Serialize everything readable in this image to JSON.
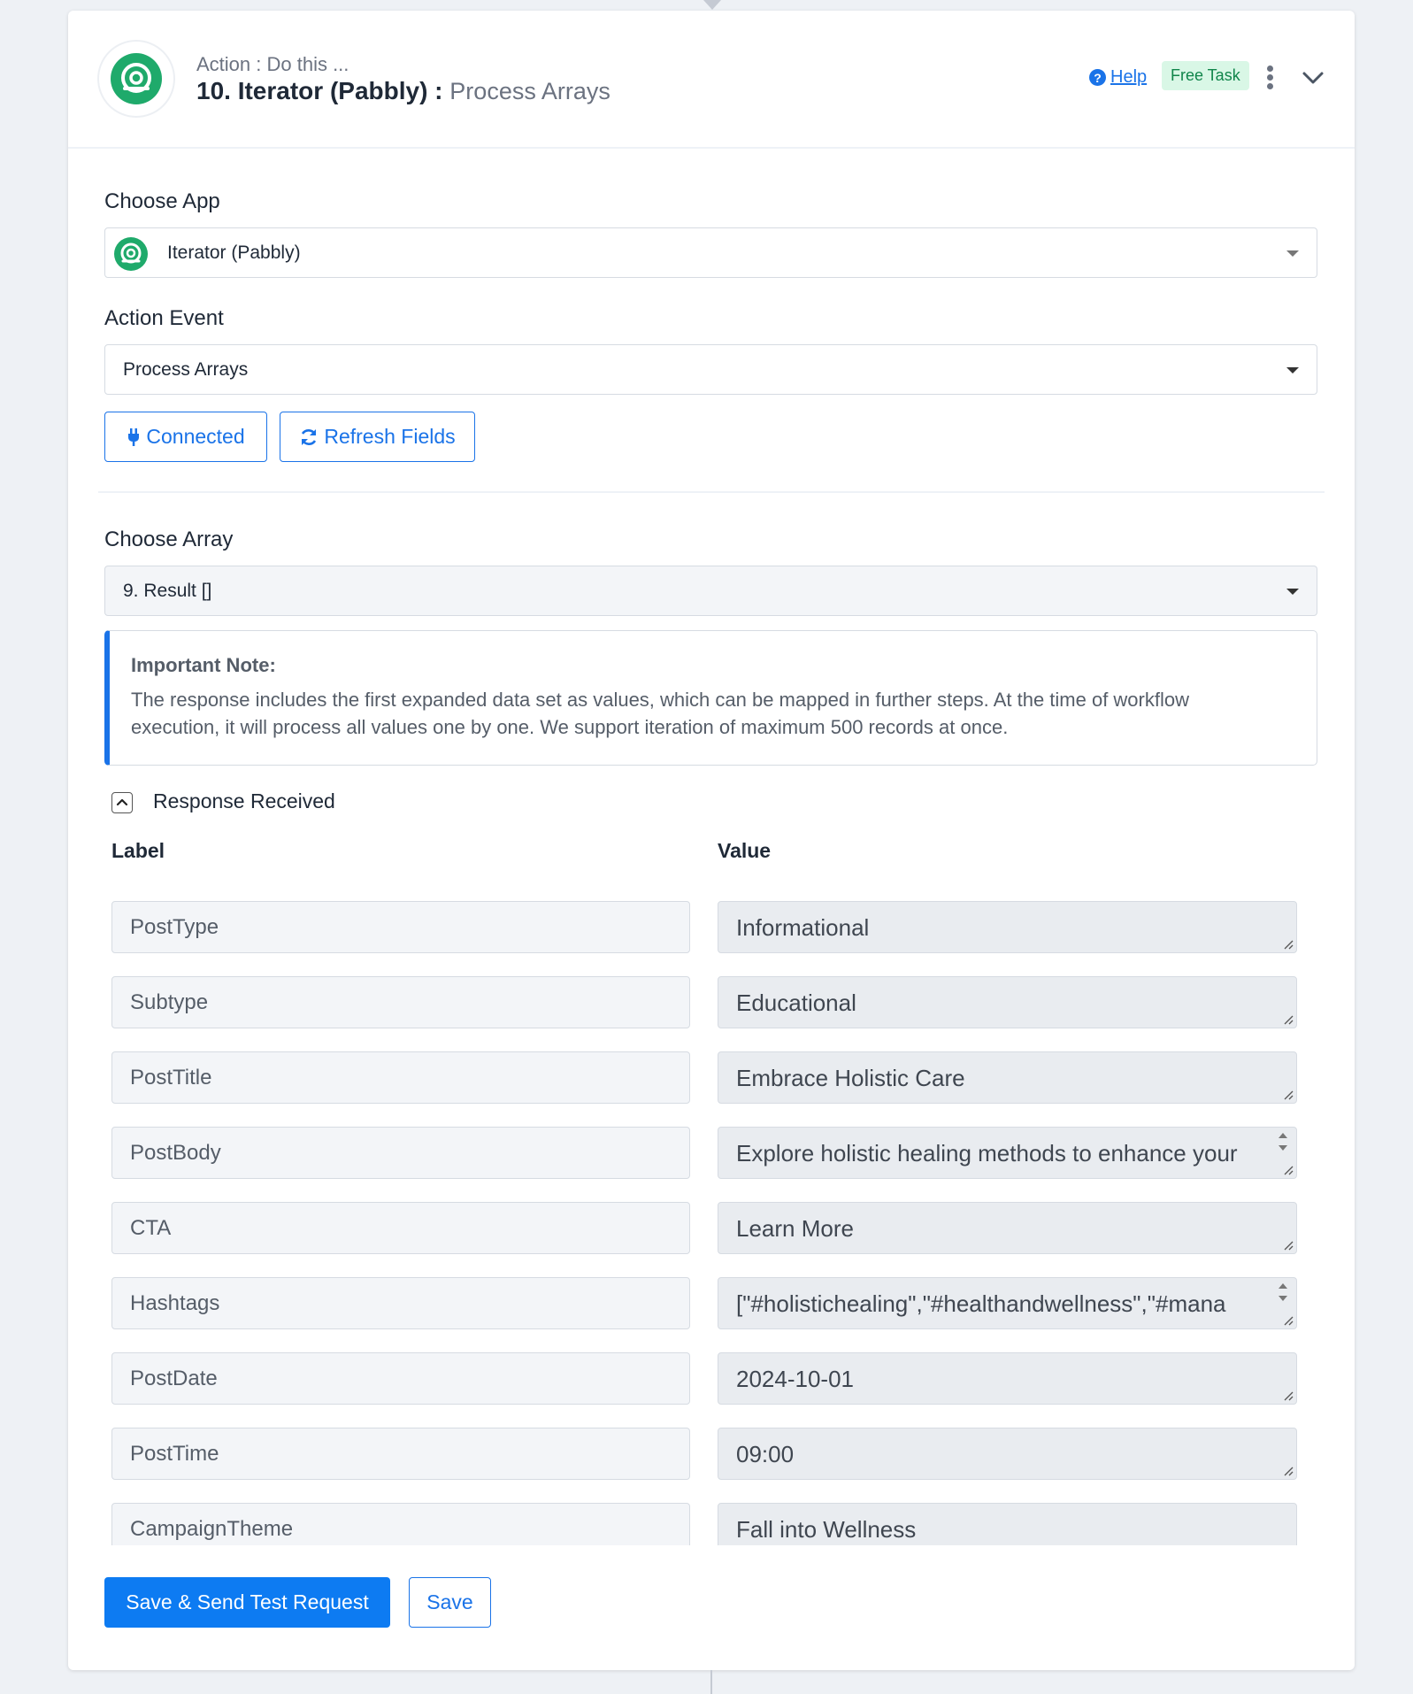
{
  "header": {
    "subtitle": "Action : Do this ...",
    "title_main": "10. Iterator (Pabbly) :",
    "title_event": "Process Arrays",
    "help_label": "Help",
    "badge": "Free Task"
  },
  "choose_app": {
    "label": "Choose App",
    "value": "Iterator (Pabbly)"
  },
  "action_event": {
    "label": "Action Event",
    "value": "Process Arrays"
  },
  "buttons": {
    "connected": "Connected",
    "refresh": "Refresh Fields",
    "save_send": "Save & Send Test Request",
    "save": "Save"
  },
  "choose_array": {
    "label": "Choose Array",
    "value": "9. Result []"
  },
  "note": {
    "title": "Important Note:",
    "body": "The response includes the first expanded data set as values, which can be mapped in further steps. At the time of workflow execution, it will process all values one by one. We support iteration of maximum 500 records at once."
  },
  "response": {
    "title": "Response Received",
    "col_label": "Label",
    "col_value": "Value",
    "rows": [
      {
        "label": "PostType",
        "value": "Informational"
      },
      {
        "label": "Subtype",
        "value": "Educational"
      },
      {
        "label": "PostTitle",
        "value": "Embrace Holistic Care"
      },
      {
        "label": "PostBody",
        "value": "Explore holistic healing methods to enhance your"
      },
      {
        "label": "CTA",
        "value": "Learn More"
      },
      {
        "label": "Hashtags",
        "value": "[\"#holistichealing\",\"#healthandwellness\",\"#mana"
      },
      {
        "label": "PostDate",
        "value": "2024-10-01"
      },
      {
        "label": "PostTime",
        "value": "09:00"
      },
      {
        "label": "CampaignTheme",
        "value": "Fall into Wellness"
      }
    ]
  },
  "colors": {
    "brand_green": "#1faa6b",
    "primary_blue": "#0d7bf2",
    "badge_bg": "#d9f7e6"
  }
}
